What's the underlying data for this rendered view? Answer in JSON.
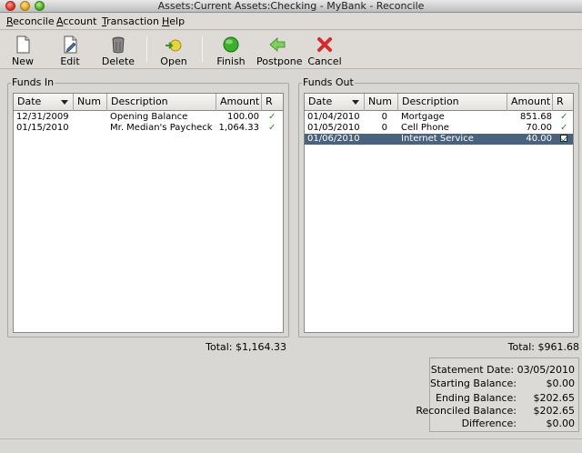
{
  "window": {
    "title": "Assets:Current Assets:Checking - MyBank - Reconcile"
  },
  "menu": [
    {
      "label": "Reconcile",
      "accel": "R",
      "rest": "econcile"
    },
    {
      "label": "Account",
      "accel": "A",
      "rest": "ccount"
    },
    {
      "label": "Transaction",
      "accel": "T",
      "rest": "ransaction"
    },
    {
      "label": "Help",
      "accel": "H",
      "rest": "elp"
    }
  ],
  "toolbar": {
    "new_label": "New",
    "edit_label": "Edit",
    "delete_label": "Delete",
    "open_label": "Open",
    "finish_label": "Finish",
    "postpone_label": "Postpone",
    "cancel_label": "Cancel"
  },
  "funds_in": {
    "label": "Funds In",
    "headers": [
      "Date",
      "Num",
      "Description",
      "Amount",
      "R"
    ],
    "rows": [
      {
        "date": "12/31/2009",
        "num": "",
        "description": "Opening Balance",
        "amount": "100.00",
        "reconciled": "✓"
      },
      {
        "date": "01/15/2010",
        "num": "",
        "description": "Mr. Median's Paycheck",
        "amount": "1,064.33",
        "reconciled": "✓"
      }
    ],
    "total": "Total: $1,164.33"
  },
  "funds_out": {
    "label": "Funds Out",
    "headers": [
      "Date",
      "Num",
      "Description",
      "Amount",
      "R"
    ],
    "rows": [
      {
        "date": "01/04/2010",
        "num": "0",
        "description": "Mortgage",
        "amount": "851.68",
        "reconciled": "✓"
      },
      {
        "date": "01/05/2010",
        "num": "0",
        "description": "Cell Phone",
        "amount": "70.00",
        "reconciled": "✓"
      },
      {
        "date": "01/06/2010",
        "num": "",
        "description": "Internet Service",
        "amount": "40.00",
        "reconciled": ""
      }
    ],
    "total": "Total: $961.68"
  },
  "summary": {
    "statement_date": "Statement Date: 03/05/2010",
    "starting_balance": "Starting Balance:",
    "starting_value": "$0.00",
    "ending_balance": "Ending Balance:",
    "ending_value": "$202.65",
    "reconciled_balance": "Reconciled Balance:",
    "reconciled_value": "$202.65",
    "difference": "Difference:",
    "difference_value": "$0.00"
  },
  "colors": {
    "selection": "#49627d",
    "check": "#2a8a2a"
  }
}
